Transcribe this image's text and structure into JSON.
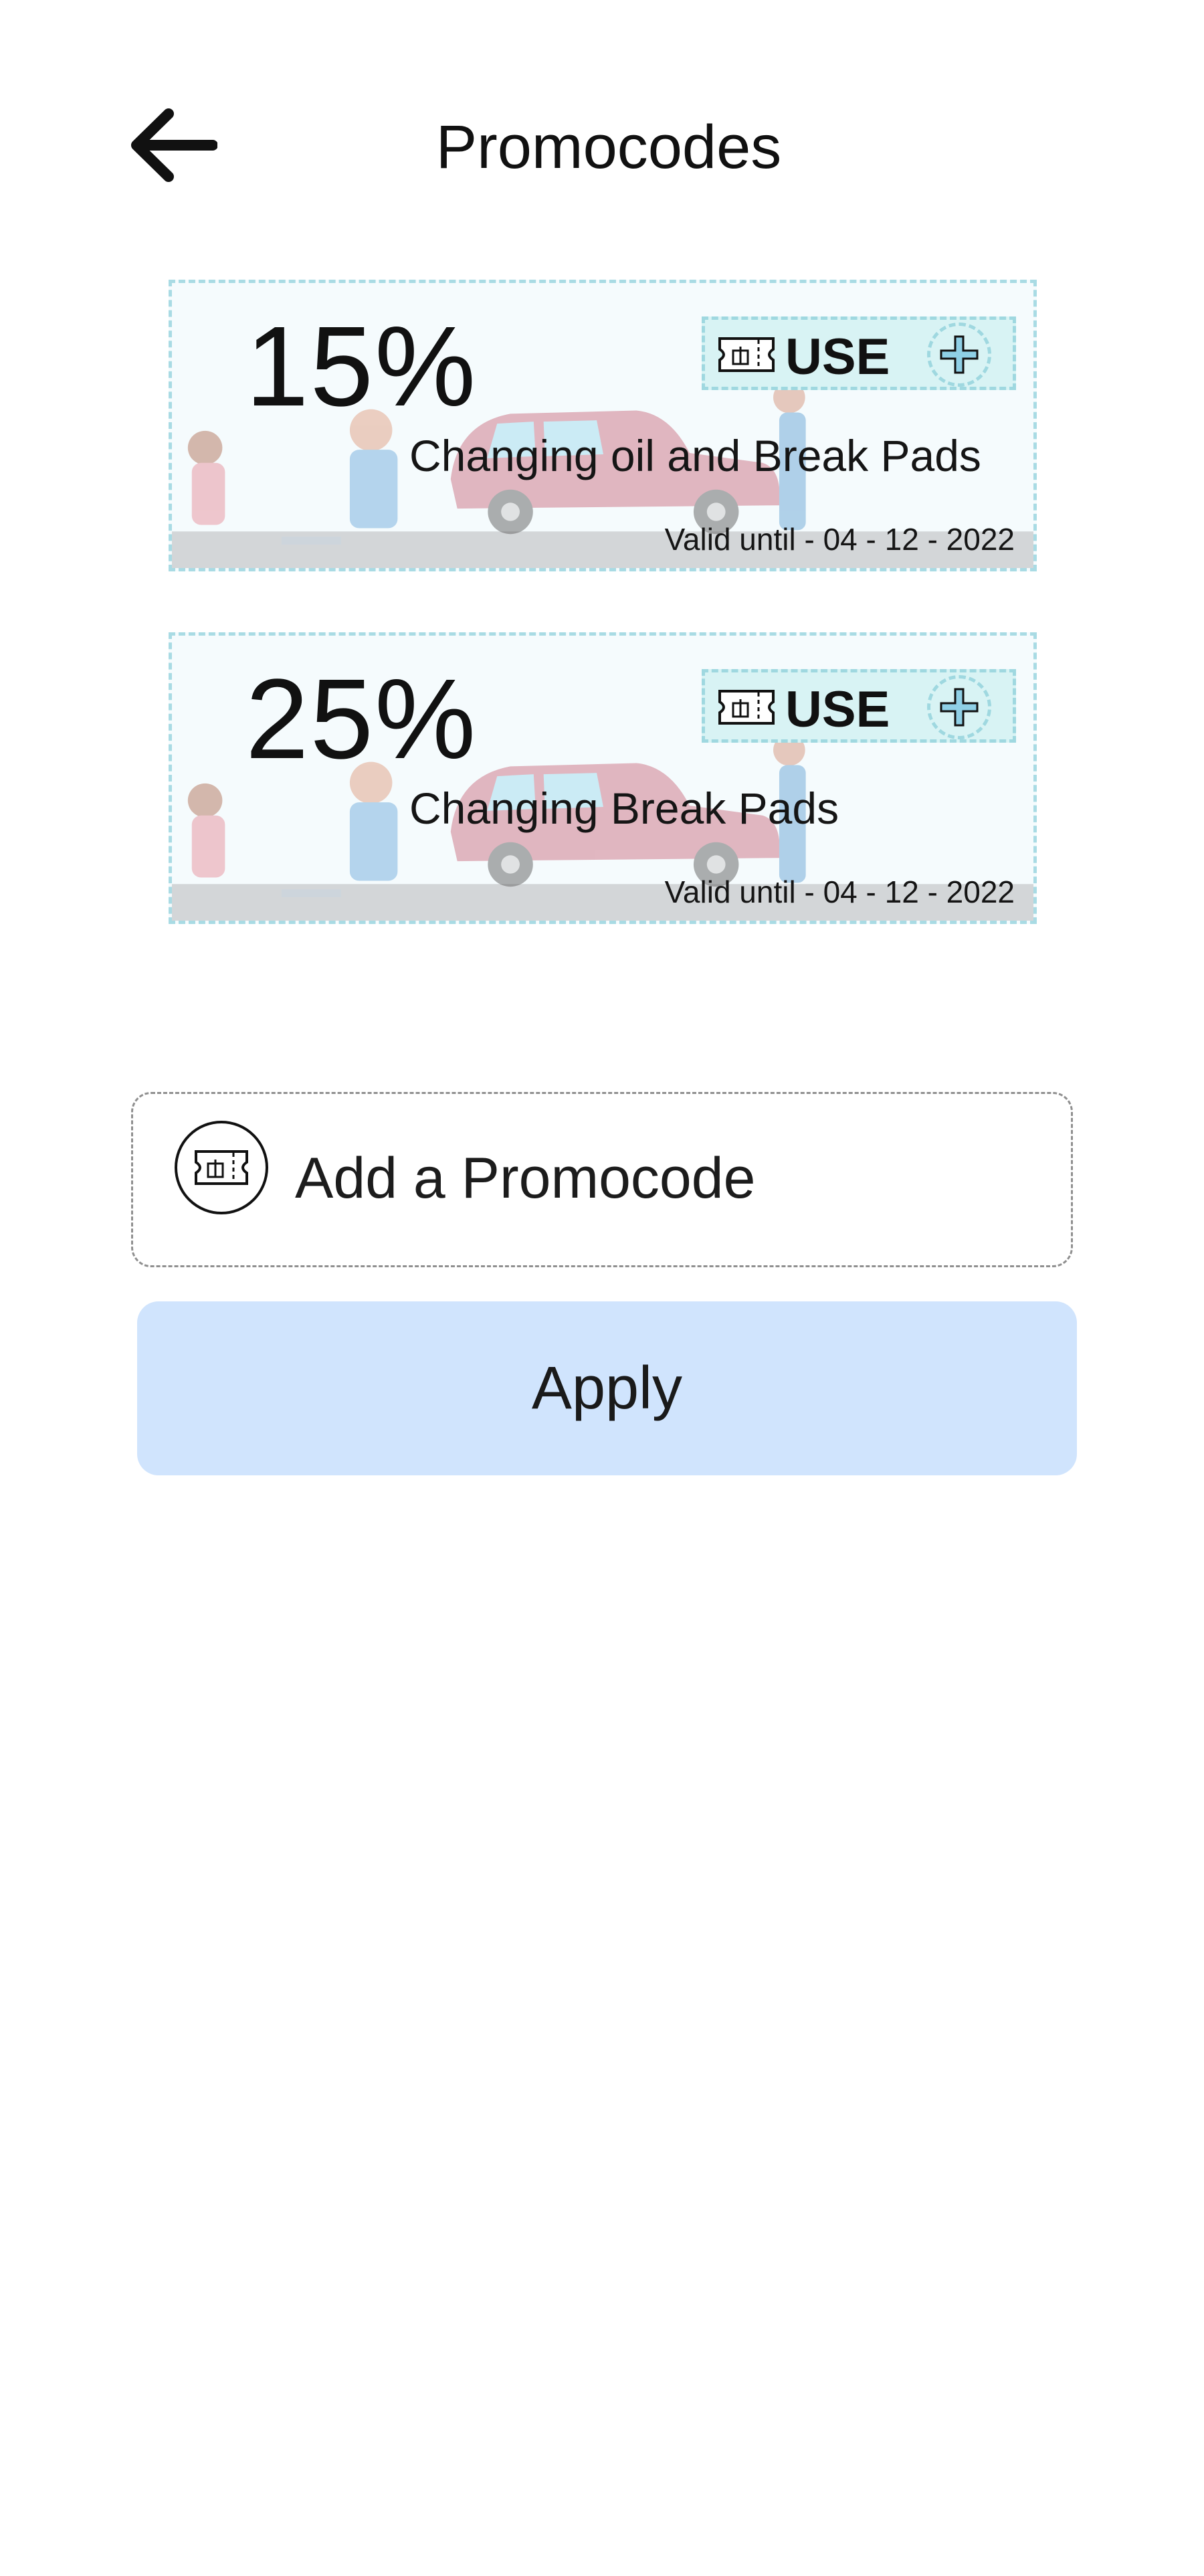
{
  "header": {
    "title": "Promocodes",
    "back_icon": "arrow-left-icon"
  },
  "promocodes": [
    {
      "discount": "15%",
      "description": "Changing oil and Break Pads",
      "valid_until": "Valid until - 04 - 12 - 2022",
      "use_label": "USE"
    },
    {
      "discount": "25%",
      "description": "Changing Break Pads",
      "valid_until": "Valid until - 04 - 12 - 2022",
      "use_label": "USE"
    }
  ],
  "add_promocode": {
    "placeholder": "Add a Promocode",
    "value": "",
    "icon": "ticket-icon"
  },
  "apply_button": {
    "label": "Apply"
  },
  "colors": {
    "card_border": "#a9dbe4",
    "use_button_bg": "#d8f3f4",
    "apply_bg": "#d0e4fd",
    "plus_fill": "#8fd0e6"
  }
}
